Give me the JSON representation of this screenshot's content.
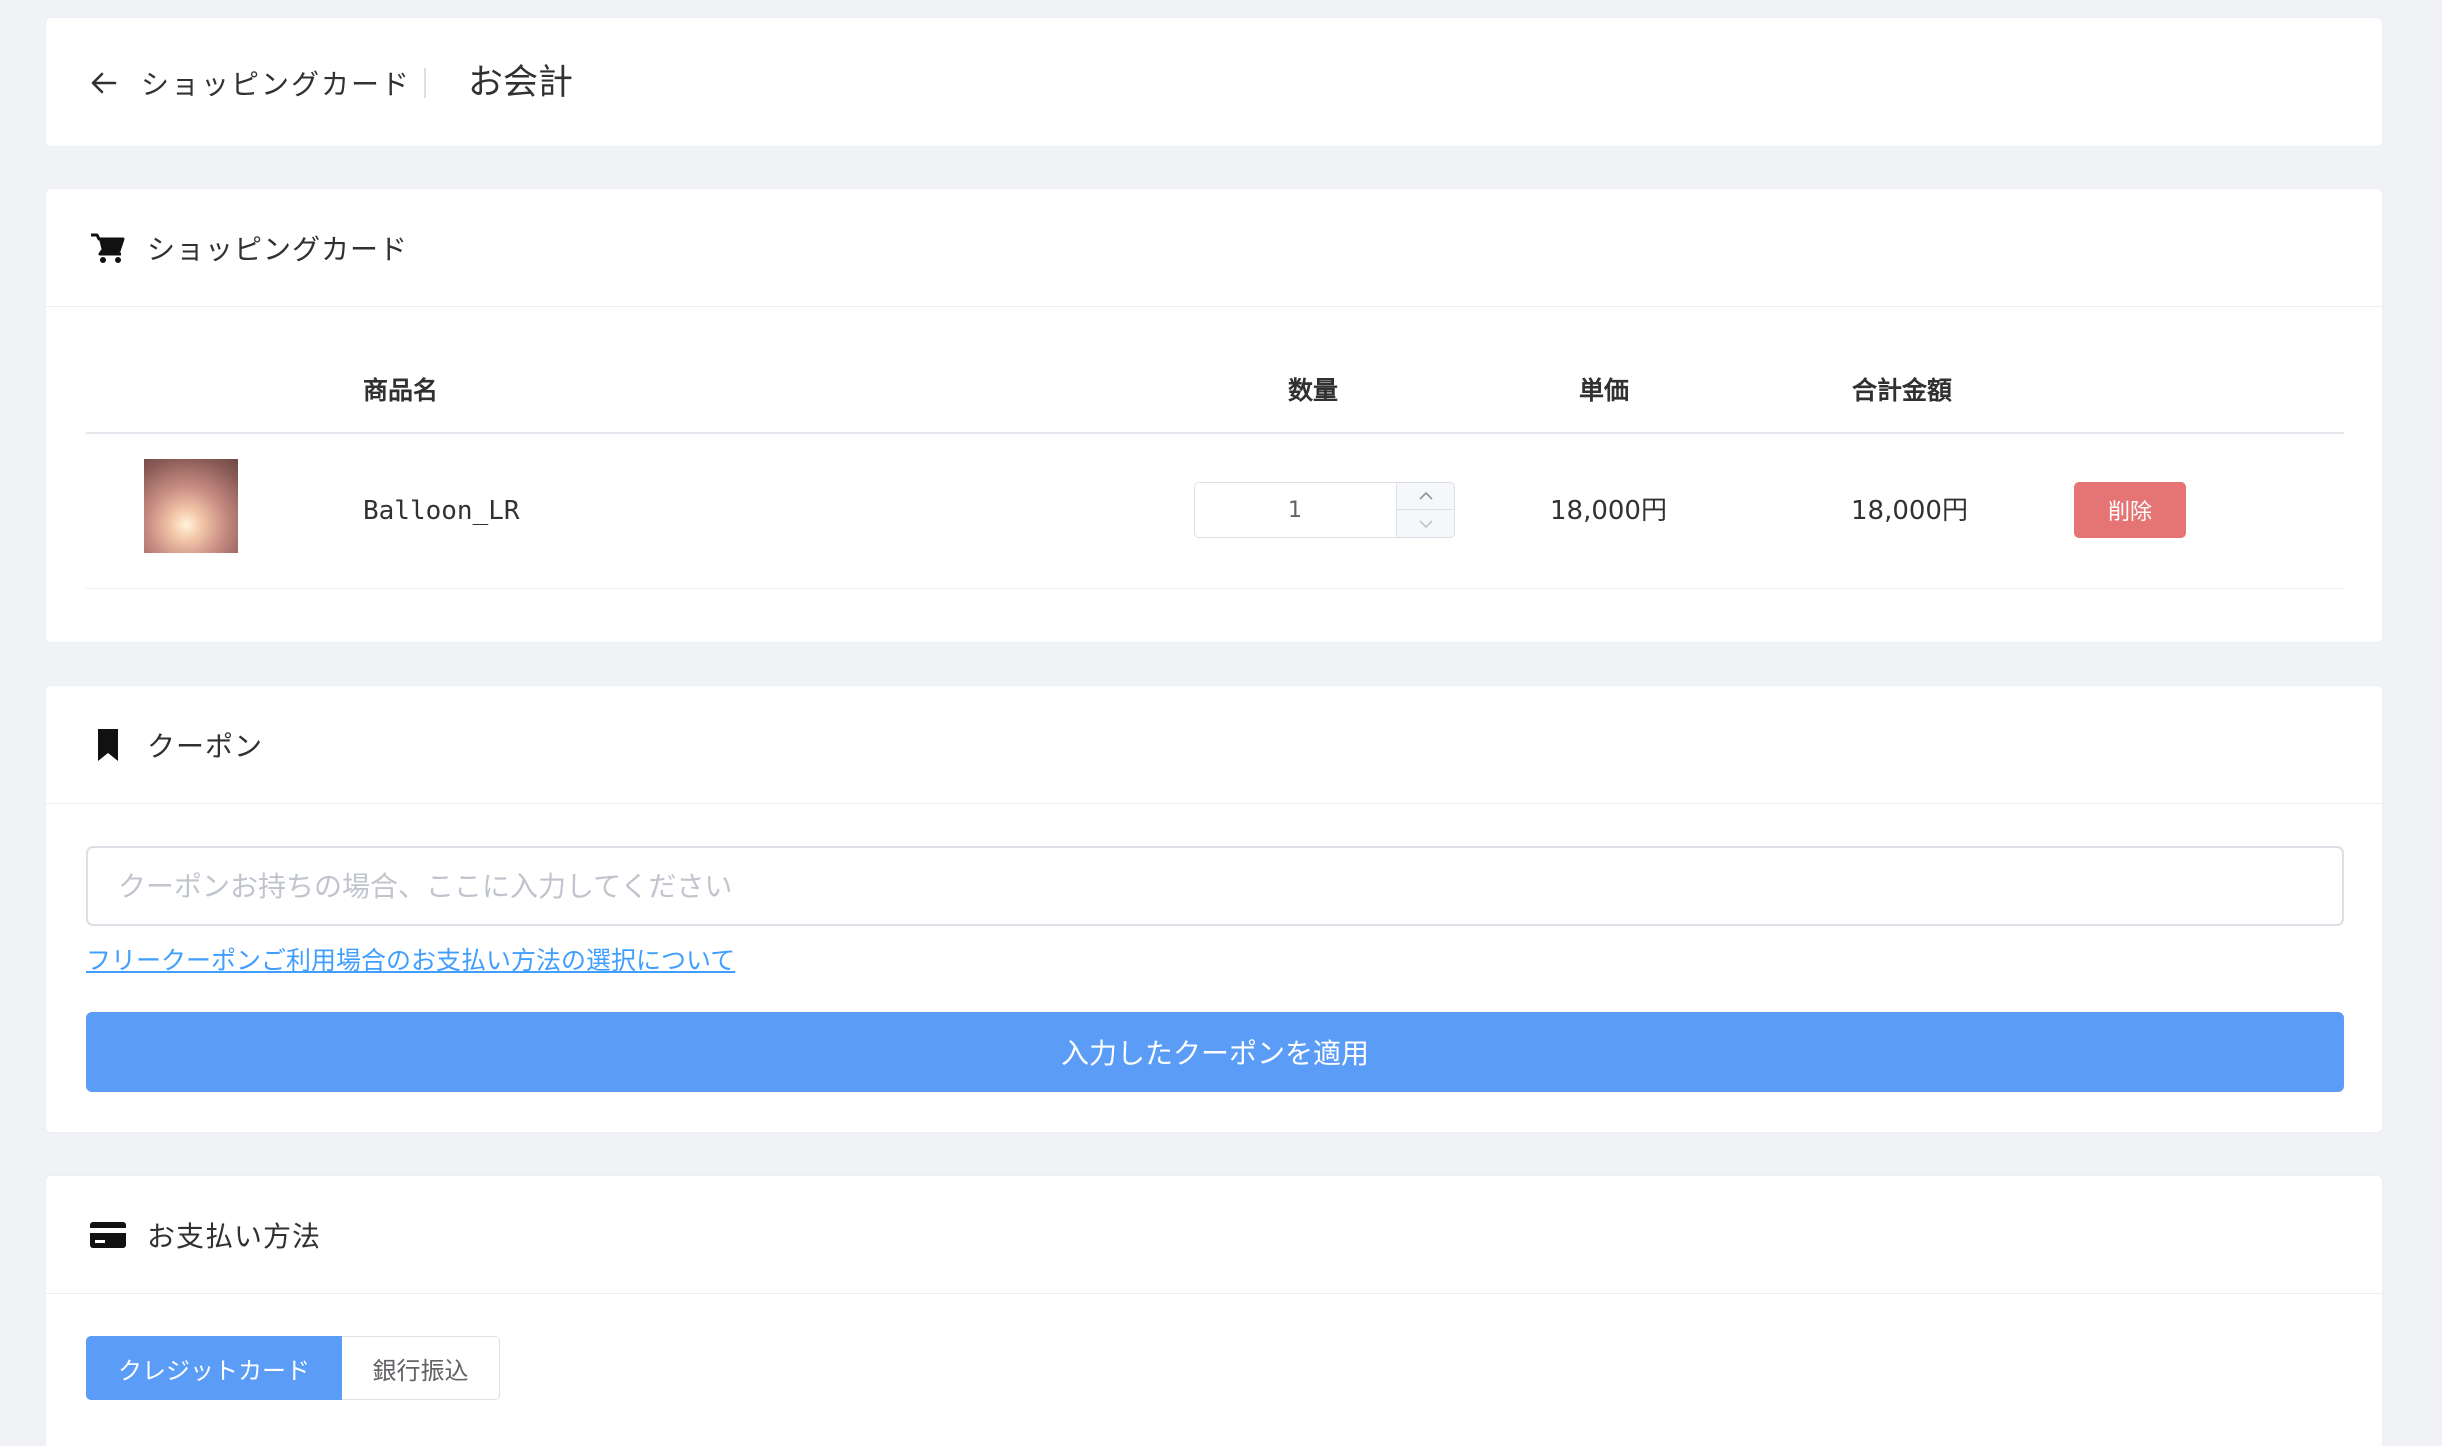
{
  "header": {
    "back_label": "ショッピングカード",
    "title": "お会計"
  },
  "cart": {
    "section_title": "ショッピングカード",
    "columns": {
      "name": "商品名",
      "quantity": "数量",
      "unit_price": "単価",
      "total": "合計金額"
    },
    "items": [
      {
        "name": "Balloon_LR",
        "quantity": "1",
        "unit_price": "18,000円",
        "total": "18,000円",
        "delete_label": "削除"
      }
    ]
  },
  "coupon": {
    "section_title": "クーポン",
    "placeholder": "クーポンお持ちの場合、ここに入力してください",
    "link_text": "フリークーポンご利用場合のお支払い方法の選択について",
    "apply_label": "入力したクーポンを適用"
  },
  "payment": {
    "section_title": "お支払い方法",
    "methods": [
      {
        "label": "クレジットカード",
        "selected": true
      },
      {
        "label": "銀行振込",
        "selected": false
      }
    ]
  },
  "colors": {
    "primary": "#5b9cf6",
    "danger": "#e57575",
    "link": "#409eff",
    "background": "#f0f2f5"
  },
  "icons": [
    "arrow-left-icon",
    "shopping-cart-icon",
    "bookmark-icon",
    "credit-card-icon",
    "chevron-up-icon",
    "chevron-down-icon"
  ]
}
